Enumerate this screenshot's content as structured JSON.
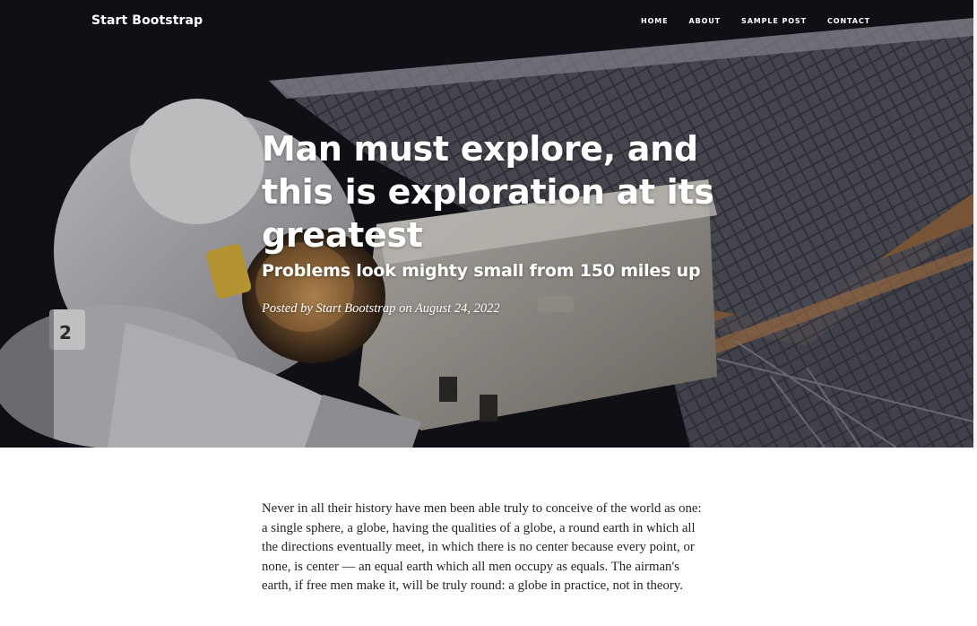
{
  "navbar": {
    "brand": "Start Bootstrap",
    "links": [
      "HOME",
      "ABOUT",
      "SAMPLE POST",
      "CONTACT"
    ]
  },
  "post": {
    "title": "Man must explore, and this is exploration at its greatest",
    "subtitle": "Problems look mighty small from 150 miles up",
    "meta": {
      "prefix": "Posted by",
      "author": "Start Bootstrap",
      "on": "on",
      "date": "August 24, 2022"
    }
  },
  "article": {
    "paragraph": "Never in all their history have men been able truly to conceive of the world as one: a single sphere, a globe, having the qualities of a globe, a round earth in which all the directions eventually meet, in which there is no center because every point, or none, is center — an equal earth which all men occupy as equals. The airman's earth, if free men make it, will be truly round: a globe in practice, not in theory."
  },
  "colors": {
    "hero_background": "#161419",
    "text_light": "#ffffff",
    "body_text": "#212529"
  },
  "icons": {
    "hero_image": "astronaut-spacewalk-illustration"
  }
}
